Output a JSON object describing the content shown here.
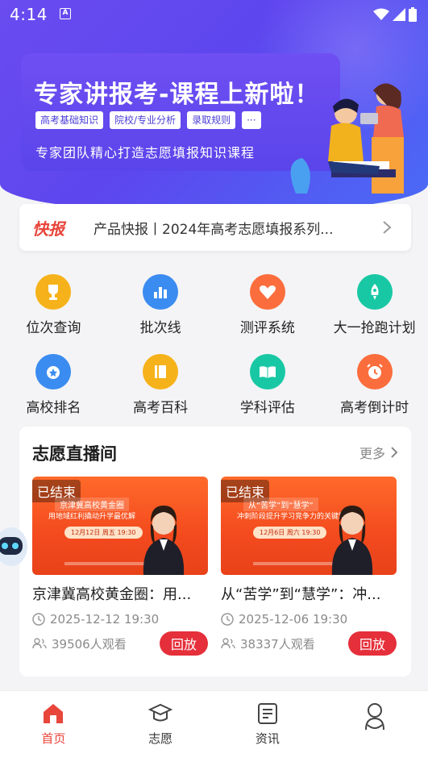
{
  "status_bar": {
    "time": "4:14",
    "notification_glyph": "A"
  },
  "hero": {
    "title": "专家讲报考-课程上新啦！",
    "tags": [
      "高考基础知识",
      "院校/专业分析",
      "录取规则",
      "···"
    ],
    "subtitle": "专家团队精心打造志愿填报知识课程"
  },
  "ticker": {
    "badge": "快报",
    "text": "产品快报丨2024年高考志愿填报系列..."
  },
  "grid": [
    {
      "label": "位次查询",
      "icon": "trophy-icon",
      "color": "#f6b21a"
    },
    {
      "label": "批次线",
      "icon": "bar-chart-icon",
      "color": "#3b8cf0"
    },
    {
      "label": "测评系统",
      "icon": "heart-icon",
      "color": "#fb6d3c"
    },
    {
      "label": "大一抢跑计划",
      "icon": "rocket-icon",
      "color": "#18c8a4"
    },
    {
      "label": "高校排名",
      "icon": "medal-icon",
      "color": "#3b8cf0"
    },
    {
      "label": "高考百科",
      "icon": "book-icon",
      "color": "#f6b21a"
    },
    {
      "label": "学科评估",
      "icon": "open-book-icon",
      "color": "#18c8a4"
    },
    {
      "label": "高考倒计时",
      "icon": "alarm-clock-icon",
      "color": "#fb6d3c"
    }
  ],
  "live": {
    "title": "志愿直播间",
    "more": "更多",
    "cards": [
      {
        "status": "已结束",
        "thumb_line1": "京津冀高校黄金圈",
        "thumb_line2": "用地域红利撬动升学最优解",
        "thumb_date": "12月12日 周五 19:30",
        "title": "京津冀高校黄金圈：用...",
        "datetime": "2025-12-12 19:30",
        "viewers": "39506人观看",
        "action": "回放"
      },
      {
        "status": "已结束",
        "thumb_line1": "从“苦学”到“慧学”",
        "thumb_line2": "冲刺阶段提升学习竞争力的关键策略",
        "thumb_date": "12月6日 周六 19:30",
        "title": "从“苦学”到“慧学”：冲...",
        "datetime": "2025-12-06 19:30",
        "viewers": "38337人观看",
        "action": "回放"
      }
    ]
  },
  "tabs": [
    {
      "label": "首页",
      "icon": "home-icon",
      "active": true
    },
    {
      "label": "志愿",
      "icon": "graduation-cap-icon",
      "active": false
    },
    {
      "label": "资讯",
      "icon": "news-icon",
      "active": false
    },
    {
      "label": "",
      "icon": "profile-icon",
      "active": false
    }
  ],
  "colors": {
    "accent": "#e8463b",
    "hero": "#5d46ee",
    "replay": "#e52f3a"
  }
}
